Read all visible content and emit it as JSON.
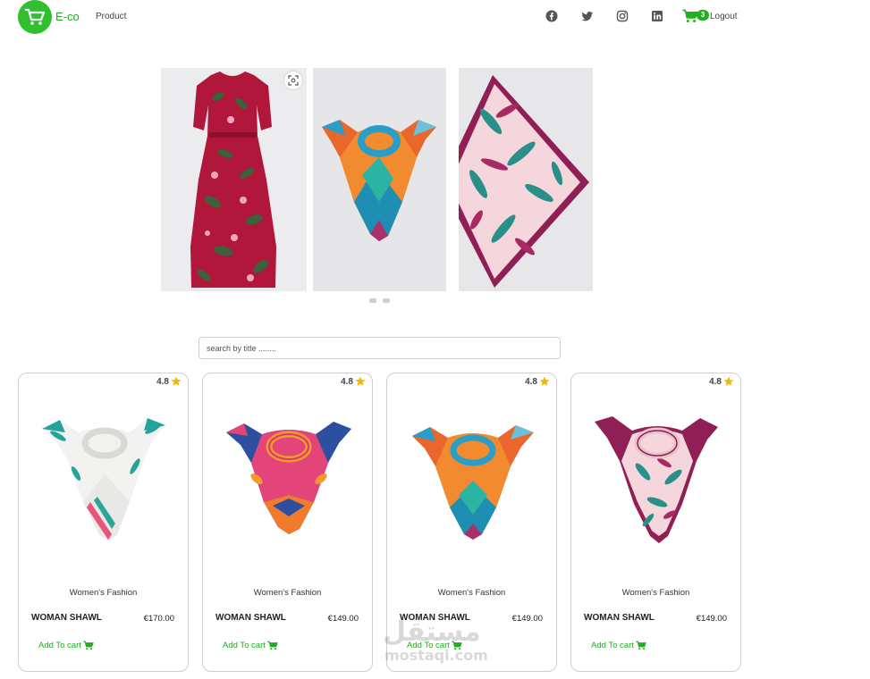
{
  "nav": {
    "brand": "E-co",
    "links": [
      "Product"
    ],
    "social_icons": [
      "facebook-icon",
      "twitter-icon",
      "instagram-icon",
      "linkedin-icon"
    ],
    "cart_count": "3",
    "logout": "Logout",
    "accent": "#22b022"
  },
  "carousel": {
    "slides": [
      "red floral dress",
      "multicolor square scarf",
      "pink leaf print scarf"
    ],
    "active_index": 0,
    "dot_count": 2
  },
  "search": {
    "placeholder": "search by title ........",
    "value": ""
  },
  "products": [
    {
      "rating": "4.8",
      "category": "Women's Fashion",
      "title": "WOMAN SHAWL",
      "price": "€170.00",
      "cta": "Add To cart"
    },
    {
      "rating": "4.8",
      "category": "Women's Fashion",
      "title": "WOMAN SHAWL",
      "price": "€149.00",
      "cta": "Add To cart"
    },
    {
      "rating": "4.8",
      "category": "Women's Fashion",
      "title": "WOMAN SHAWL",
      "price": "€149.00",
      "cta": "Add To cart"
    },
    {
      "rating": "4.8",
      "category": "Women's Fashion",
      "title": "WOMAN SHAWL",
      "price": "€149.00",
      "cta": "Add To cart"
    }
  ],
  "watermark": {
    "text": "مستقل",
    "sub": "mostaqi.com"
  }
}
